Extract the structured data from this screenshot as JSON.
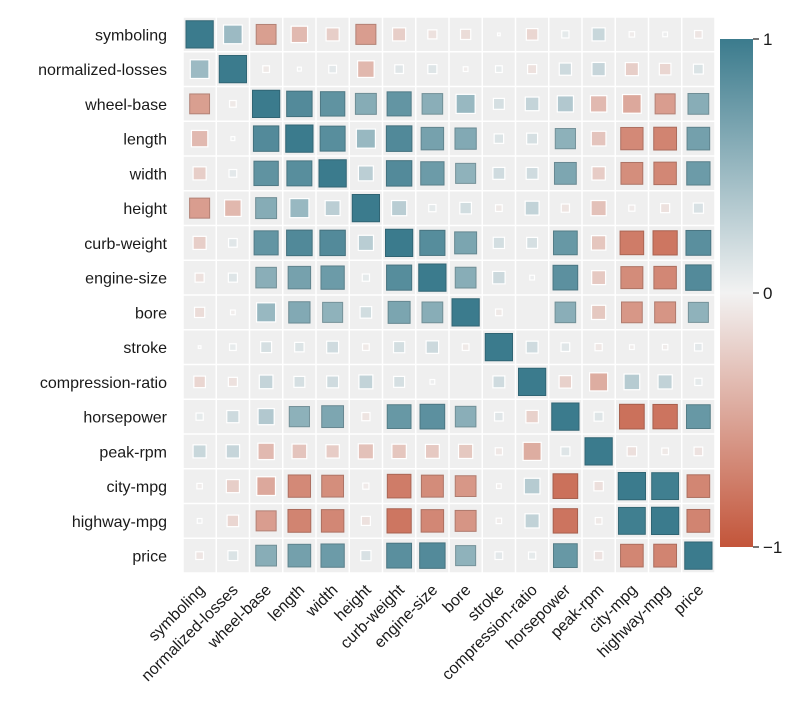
{
  "chart_data": {
    "type": "heatmap",
    "title": "",
    "xlabel": "",
    "ylabel": "",
    "marker": "square sized by |value|",
    "variables": [
      "symboling",
      "normalized-losses",
      "wheel-base",
      "length",
      "width",
      "height",
      "curb-weight",
      "engine-size",
      "bore",
      "stroke",
      "compression-ratio",
      "horsepower",
      "peak-rpm",
      "city-mpg",
      "highway-mpg",
      "price"
    ],
    "matrix": [
      [
        1.0,
        0.47,
        -0.53,
        -0.36,
        -0.23,
        -0.54,
        -0.23,
        -0.11,
        -0.14,
        -0.01,
        -0.18,
        0.07,
        0.23,
        -0.04,
        0.03,
        -0.08
      ],
      [
        0.47,
        1.0,
        -0.06,
        0.02,
        0.08,
        -0.37,
        0.1,
        0.11,
        -0.03,
        0.06,
        -0.11,
        0.2,
        0.24,
        -0.23,
        -0.18,
        0.13
      ],
      [
        -0.53,
        -0.06,
        1.0,
        0.87,
        0.8,
        0.59,
        0.78,
        0.57,
        0.49,
        0.16,
        0.25,
        0.35,
        -0.36,
        -0.47,
        -0.54,
        0.58
      ],
      [
        -0.36,
        0.02,
        0.87,
        1.0,
        0.84,
        0.49,
        0.88,
        0.68,
        0.61,
        0.12,
        0.16,
        0.55,
        -0.29,
        -0.67,
        -0.7,
        0.69
      ],
      [
        -0.23,
        0.08,
        0.8,
        0.84,
        1.0,
        0.3,
        0.87,
        0.73,
        0.54,
        0.19,
        0.19,
        0.64,
        -0.24,
        -0.64,
        -0.68,
        0.73
      ],
      [
        -0.54,
        -0.37,
        0.59,
        0.49,
        0.3,
        1.0,
        0.31,
        0.07,
        0.18,
        -0.06,
        0.26,
        -0.09,
        -0.31,
        -0.05,
        -0.11,
        0.14
      ],
      [
        -0.23,
        0.1,
        0.78,
        0.88,
        0.87,
        0.31,
        1.0,
        0.85,
        0.65,
        0.17,
        0.16,
        0.76,
        -0.28,
        -0.75,
        -0.79,
        0.83
      ],
      [
        -0.11,
        0.11,
        0.57,
        0.68,
        0.73,
        0.07,
        0.85,
        1.0,
        0.58,
        0.21,
        0.03,
        0.82,
        -0.26,
        -0.65,
        -0.68,
        0.87
      ],
      [
        -0.14,
        -0.03,
        0.49,
        0.61,
        0.54,
        0.18,
        0.65,
        0.58,
        1.0,
        -0.06,
        0.0,
        0.57,
        -0.27,
        -0.58,
        -0.59,
        0.54
      ],
      [
        -0.01,
        0.06,
        0.16,
        0.12,
        0.19,
        -0.06,
        0.17,
        0.21,
        -0.06,
        1.0,
        0.19,
        0.1,
        -0.07,
        -0.03,
        -0.04,
        0.08
      ],
      [
        -0.18,
        -0.11,
        0.25,
        0.16,
        0.19,
        0.26,
        0.16,
        0.03,
        0.0,
        0.19,
        1.0,
        -0.21,
        -0.44,
        0.33,
        0.27,
        0.07
      ],
      [
        0.07,
        0.2,
        0.35,
        0.55,
        0.64,
        -0.09,
        0.76,
        0.82,
        0.57,
        0.1,
        -0.21,
        1.0,
        0.11,
        -0.82,
        -0.8,
        0.76
      ],
      [
        0.23,
        0.24,
        -0.36,
        -0.29,
        -0.24,
        -0.31,
        -0.28,
        -0.26,
        -0.27,
        -0.07,
        -0.44,
        0.11,
        1.0,
        -0.12,
        -0.06,
        -0.1
      ],
      [
        -0.04,
        -0.23,
        -0.47,
        -0.67,
        -0.64,
        -0.05,
        -0.75,
        -0.65,
        -0.58,
        -0.03,
        0.33,
        -0.82,
        -0.12,
        1.0,
        0.97,
        -0.69
      ],
      [
        0.03,
        -0.18,
        -0.54,
        -0.7,
        -0.68,
        -0.11,
        -0.79,
        -0.68,
        -0.59,
        -0.04,
        0.27,
        -0.8,
        -0.06,
        0.97,
        1.0,
        -0.7
      ],
      [
        -0.08,
        0.13,
        0.58,
        0.69,
        0.73,
        0.14,
        0.83,
        0.87,
        0.54,
        0.08,
        0.07,
        0.76,
        -0.1,
        -0.69,
        -0.7,
        1.0
      ]
    ],
    "value_range": [
      -1,
      1
    ],
    "colorbar": {
      "ticks": [
        1,
        0,
        -1
      ],
      "tick_labels": [
        "1",
        "0",
        "−1"
      ],
      "colors": {
        "negative": "#c3553a",
        "zero": "#f2f2f2",
        "positive": "#3b7b8d"
      }
    },
    "cell_background": "#efefef",
    "grid": true
  }
}
